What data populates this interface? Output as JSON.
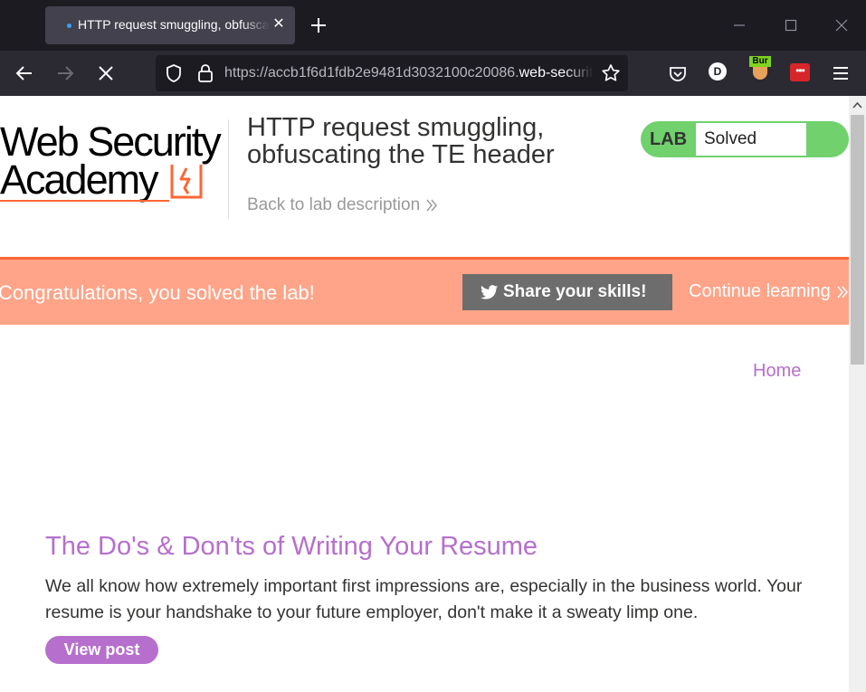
{
  "browser": {
    "tab": {
      "title": "HTTP request smuggling, obfuscating the TE header",
      "close": "✕"
    },
    "url": {
      "prefix": "https://accb1f6d1fdb2e9481d3032100c20086.",
      "domain": "web-security-academy.net"
    },
    "avatar_letter": "D",
    "burp_label": "Bur",
    "ext_dots": "•••"
  },
  "header": {
    "logo_line1": "Web Security",
    "logo_line2": "Academy",
    "lab_title": "HTTP request smuggling, obfuscating the TE header",
    "back_link": "Back to lab description",
    "lab_badge": {
      "label": "LAB",
      "status": "Solved"
    }
  },
  "congrats": {
    "message": "Congratulations, you solved the lab!",
    "share_label": "Share your skills!",
    "continue_label": "Continue learning"
  },
  "nav": {
    "home": "Home"
  },
  "post": {
    "title": "The Do's & Don'ts of Writing Your Resume",
    "summary": "We all know how extremely important first impressions are, especially in the business world. Your resume is your handshake to your future employer, don't make it a sweaty limp one.",
    "button": "View post"
  },
  "colors": {
    "accent_purple": "#b66fcd",
    "orange": "#ff6633",
    "congrats_bg": "#ffa488",
    "lab_green": "#70d16d",
    "chrome_dark": "#1c1b22",
    "chrome_mid": "#2b2a33"
  },
  "icons": [
    "shield-icon",
    "lock-icon",
    "star-icon",
    "pocket-icon",
    "twitter-icon",
    "menu-icon",
    "back-arrow-icon",
    "forward-arrow-icon",
    "stop-icon"
  ]
}
